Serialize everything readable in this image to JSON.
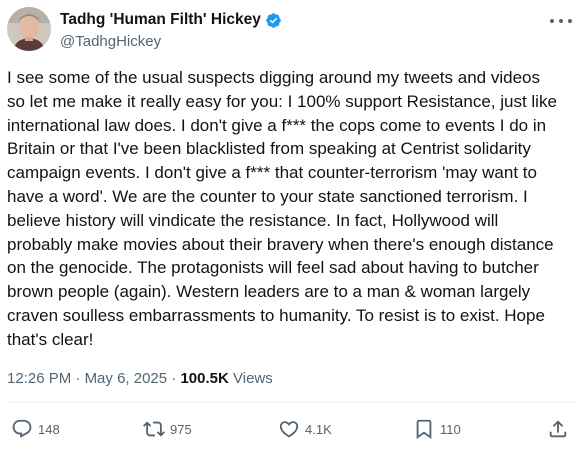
{
  "author": {
    "display_name": "Tadhg 'Human Filth' Hickey",
    "handle": "@TadhgHickey",
    "verified": true
  },
  "tweet": {
    "text": "I see some of the usual suspects digging around my tweets and videos\nso let me make it really easy for you: I 100% support Resistance, just like\ninternational law does. I don't give a f*** the cops come to events I do in\nBritain or that I've been blacklisted from speaking at Centrist solidarity\ncampaign events. I don't give a f*** that counter-terrorism 'may want to\nhave a word'. We are the counter to your state sanctioned terrorism. I\nbelieve history will vindicate the resistance. In fact, Hollywood will\nprobably make movies about their bravery when there's enough distance\non the genocide. The protagonists will feel sad about having to butcher\nbrown people (again). Western leaders are to a man & woman largely\ncraven soulless embarrassments to humanity. To resist is to exist. Hope\nthat's clear!",
    "time": "12:26 PM",
    "separator": "·",
    "date": "May 6, 2025",
    "views_count": "100.5K",
    "views_label": "Views"
  },
  "actions": {
    "replies": "148",
    "reposts": "975",
    "likes": "4.1K",
    "bookmarks": "110"
  },
  "icons": {
    "verified": "verified-badge-icon",
    "more": "more-options-icon",
    "reply": "reply-icon",
    "repost": "repost-icon",
    "like": "heart-icon",
    "bookmark": "bookmark-icon",
    "share": "share-icon"
  },
  "colors": {
    "text": "#0f1419",
    "secondary": "#536471",
    "verified": "#1d9bf0",
    "divider": "#eff3f4"
  }
}
